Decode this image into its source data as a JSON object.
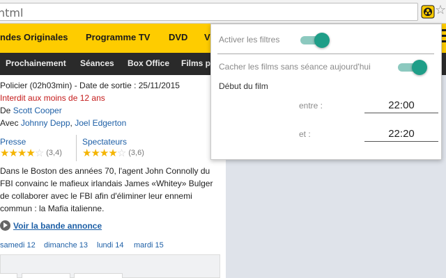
{
  "browser": {
    "url_text": "html",
    "extension_icon": "allocine-extension-icon",
    "bookmark_icon": "star-icon"
  },
  "nav_main": {
    "items": [
      "ndes Originales",
      "Programme TV",
      "DVD",
      "V"
    ]
  },
  "nav_sub": {
    "items": [
      "Prochainement",
      "Séances",
      "Box Office",
      "Films po"
    ]
  },
  "movie": {
    "genre_line": "Policier (02h03min) - Date de sortie : 25/11/2015",
    "rating_warning": "Interdit aux moins de 12 ans",
    "director_prefix": "De",
    "director": "Scott Cooper",
    "cast_prefix": "Avec",
    "actor_1": "Johnny Depp",
    "cast_sep": ",",
    "actor_2": "Joel Edgerton",
    "press_label": "Presse",
    "press_score": "(3,4)",
    "press_stars_value": 3.4,
    "spectators_label": "Spectateurs",
    "spectators_score": "(3,6)",
    "spectators_stars_value": 3.6,
    "synopsis": "Dans le Boston des années 70, l'agent John Connolly du FBI convainc le mafieux irlandais James «Whitey» Bulger de collaborer avec le FBI afin d'éliminer leur ennemi commun : la Mafia italienne.",
    "trailer_label": "Voir la bande annonce",
    "days": [
      "samedi 12",
      "dimanche 13",
      "lundi 14",
      "mardi 15"
    ]
  },
  "popup": {
    "activate_label": "Activer les filtres",
    "activate_on": true,
    "hide_label": "Cacher les films sans séance aujourd'hui",
    "hide_on": true,
    "start_label": "Début du film",
    "between_label": "entre :",
    "between_value": "22:00",
    "and_label": "et :",
    "and_value": "22:20"
  },
  "colors": {
    "brand_yellow": "#fecc00",
    "toggle_accent": "#1f9e88",
    "link_blue": "#1d5fa6",
    "warning_red": "#c41a1a"
  }
}
